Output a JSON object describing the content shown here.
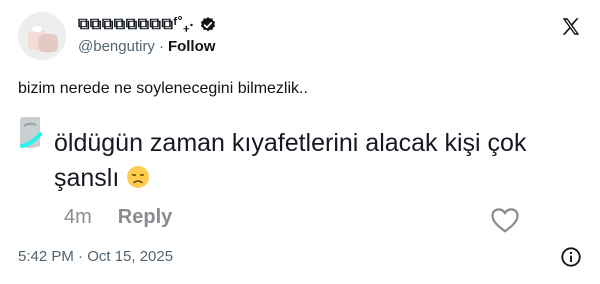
{
  "author": {
    "display_name": "⧉⧉⧉⧉⧉⧉⧉⧉ᶠ˚₊‧",
    "handle": "@bengutiry",
    "separator": "·",
    "follow_label": "Follow"
  },
  "tweet": {
    "text": "bizim nerede ne soylenecegini bilmezlik.."
  },
  "comment": {
    "text": "öldügün zaman kıyafetlerini alacak kişi çok şanslı",
    "time_ago": "4m",
    "reply_label": "Reply"
  },
  "footer": {
    "timestamp": "5:42 PM · Oct 15, 2025"
  },
  "icons": {
    "verified": "verified-badge-icon",
    "x_logo": "x-logo-icon",
    "heart": "heart-icon",
    "info": "info-icon",
    "emoji": "disappointed-face-emoji"
  },
  "colors": {
    "text": "#0f1419",
    "muted": "#536471",
    "comment_text": "#161823",
    "comment_meta": "#8a8b91",
    "tiktok_teal": "#25f4ee"
  }
}
